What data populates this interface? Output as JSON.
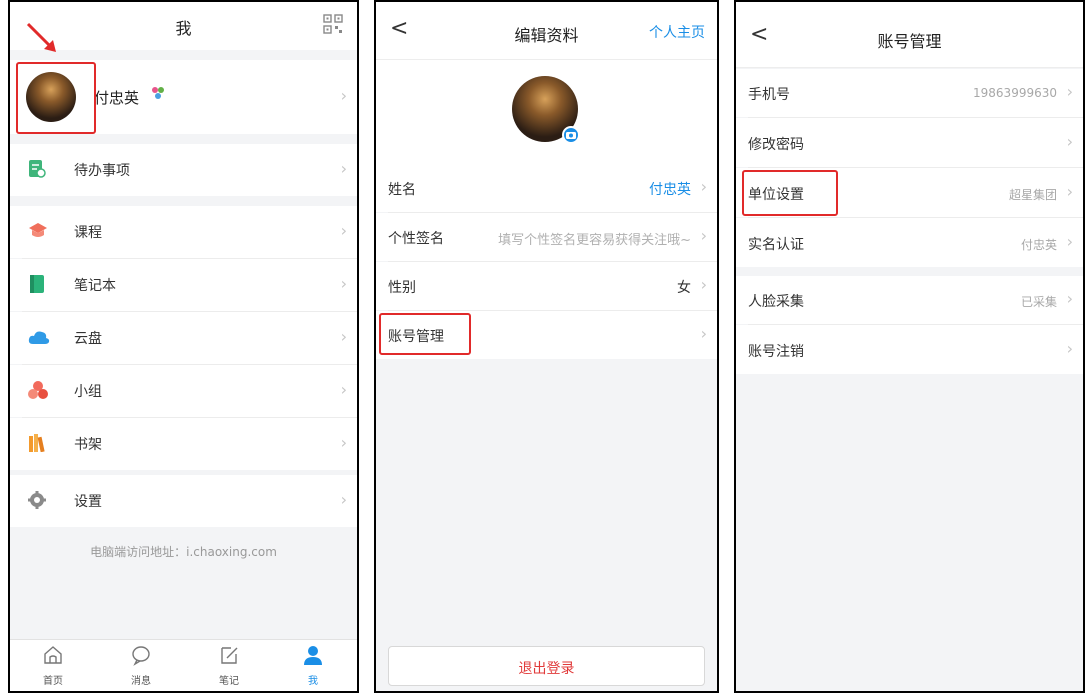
{
  "panel_me": {
    "title": "我",
    "qr_icon": "qr-code-icon",
    "user_name": "付忠英",
    "menu": [
      {
        "label": "待办事项",
        "icon": "todo-icon",
        "color": "#3fb57b"
      },
      {
        "label": "课程",
        "icon": "course-icon",
        "color": "#f06f5b"
      },
      {
        "label": "笔记本",
        "icon": "notebook-icon",
        "color": "#2bb37a"
      },
      {
        "label": "云盘",
        "icon": "cloud-icon",
        "color": "#2f9ae6"
      },
      {
        "label": "小组",
        "icon": "group-icon",
        "color": "#f26a5c"
      },
      {
        "label": "书架",
        "icon": "bookshelf-icon",
        "color": "#f39a2d"
      },
      {
        "label": "设置",
        "icon": "gear-icon",
        "color": "#8a8a8a"
      }
    ],
    "footer_note": "电脑端访问地址：i.chaoxing.com",
    "tabs": [
      {
        "label": "首页",
        "icon": "home-icon"
      },
      {
        "label": "消息",
        "icon": "message-icon"
      },
      {
        "label": "笔记",
        "icon": "note-edit-icon"
      },
      {
        "label": "我",
        "icon": "person-icon"
      }
    ]
  },
  "panel_edit": {
    "back": "<",
    "title": "编辑资料",
    "homepage_link": "个人主页",
    "rows": [
      {
        "label": "姓名",
        "value": "付忠英"
      },
      {
        "label": "个性签名",
        "value": "填写个性签名更容易获得关注哦~"
      },
      {
        "label": "性别",
        "value": "女"
      },
      {
        "label": "账号管理",
        "value": ""
      }
    ],
    "logout": "退出登录"
  },
  "panel_account": {
    "back": "<",
    "title": "账号管理",
    "rows": [
      {
        "label": "手机号",
        "value": "19863999630"
      },
      {
        "label": "修改密码",
        "value": ""
      },
      {
        "label": "单位设置",
        "value": "超星集团"
      },
      {
        "label": "实名认证",
        "value": "付忠英"
      },
      {
        "label": "人脸采集",
        "value": "已采集"
      },
      {
        "label": "账号注销",
        "value": ""
      }
    ]
  },
  "colors": {
    "accent": "#1a8ee6",
    "highlight": "#e12a2a",
    "logout": "#e13a3a"
  }
}
